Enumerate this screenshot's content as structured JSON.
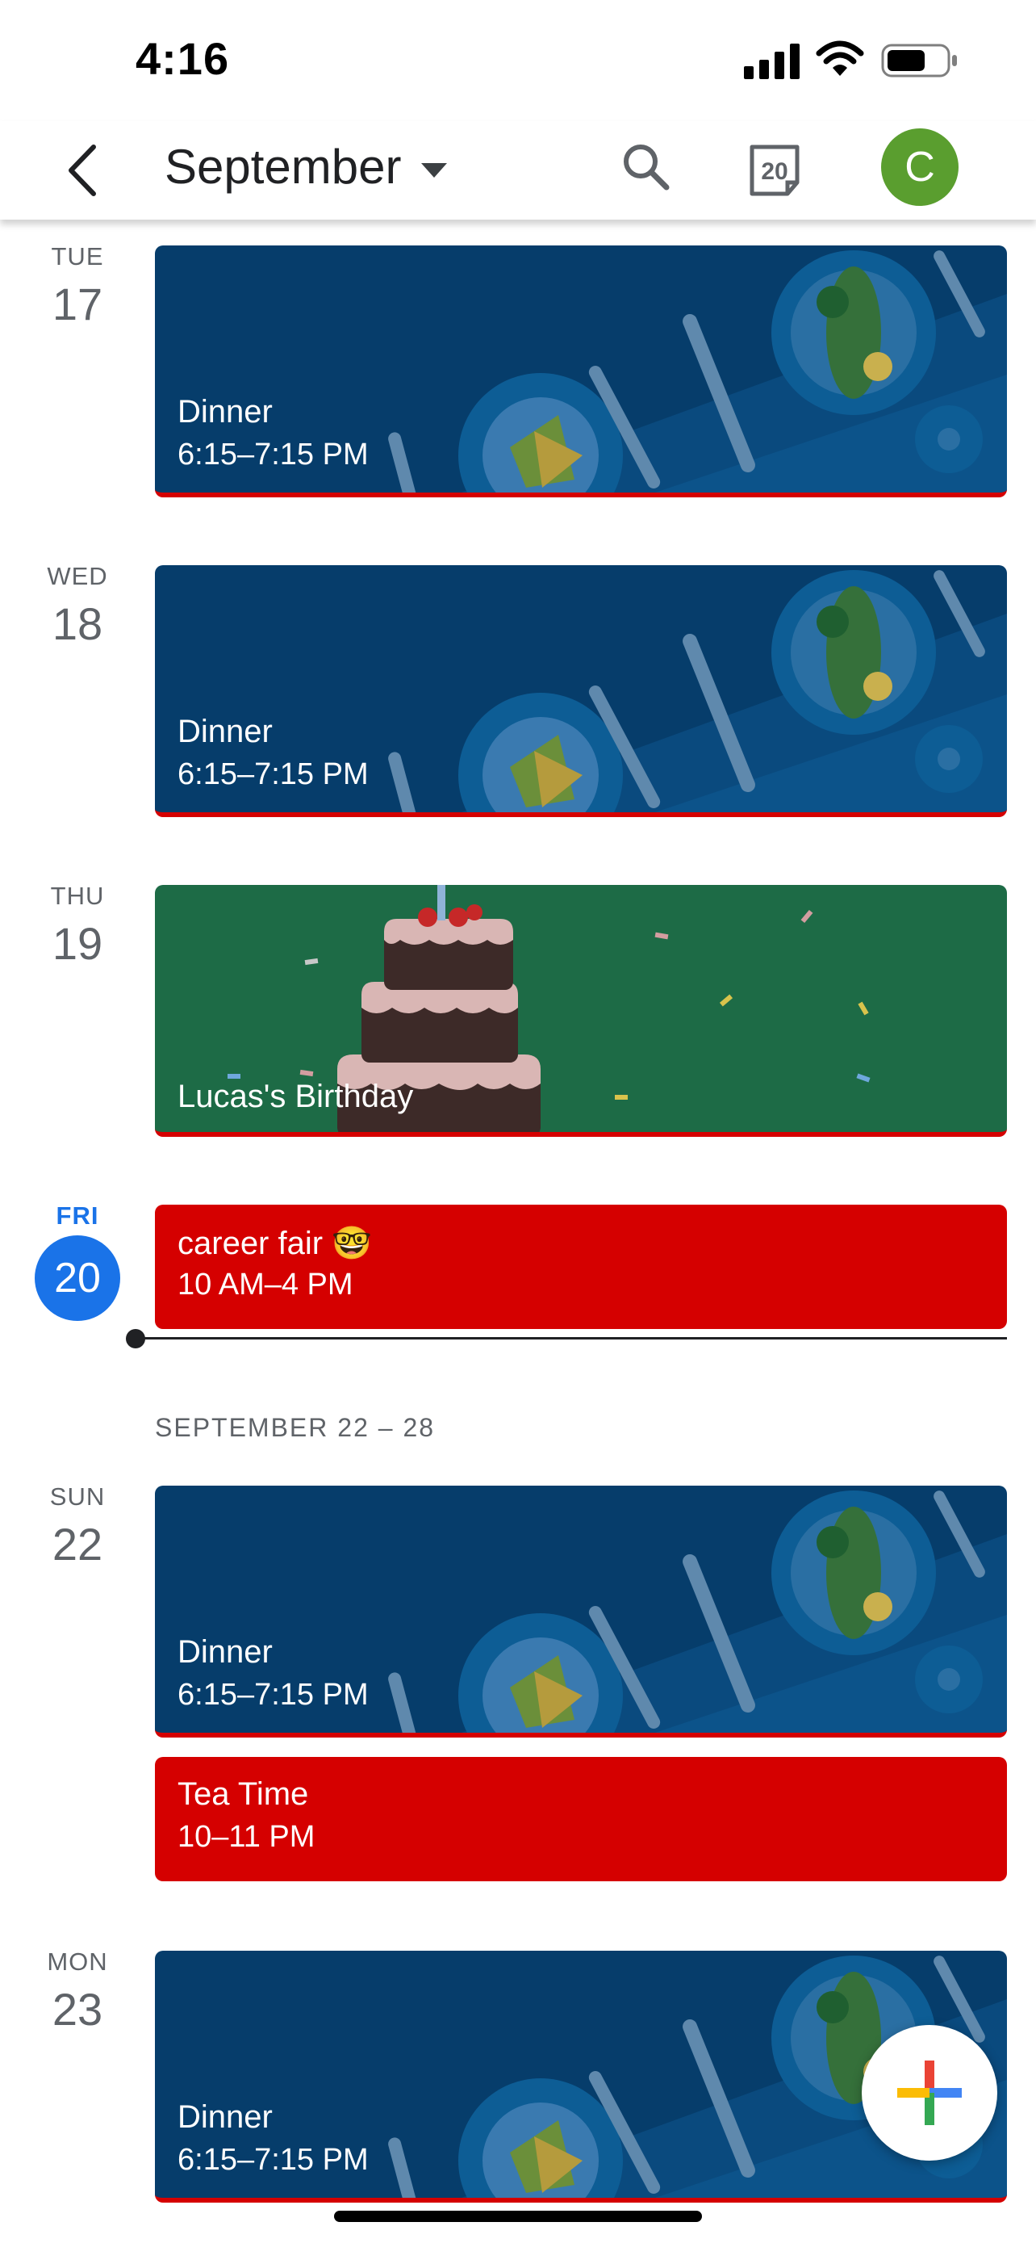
{
  "status_bar": {
    "time": "4:16"
  },
  "app_bar": {
    "month": "September",
    "today_number": "20",
    "avatar_initial": "C"
  },
  "days": [
    {
      "dow": "TUE",
      "date": "17"
    },
    {
      "dow": "WED",
      "date": "18"
    },
    {
      "dow": "THU",
      "date": "19"
    },
    {
      "dow": "FRI",
      "date": "20"
    },
    {
      "dow": "SUN",
      "date": "22"
    },
    {
      "dow": "MON",
      "date": "23"
    }
  ],
  "events": [
    {
      "title": "Dinner",
      "time": "6:15–7:15 PM"
    },
    {
      "title": "Dinner",
      "time": "6:15–7:15 PM"
    },
    {
      "title": "Lucas's Birthday"
    },
    {
      "title": "career fair 🤓",
      "time": "10 AM–4 PM"
    },
    {
      "title": "Dinner",
      "time": "6:15–7:15 PM"
    },
    {
      "title": "Tea Time",
      "time": "10–11 PM"
    },
    {
      "title": "Dinner",
      "time": "6:15–7:15 PM"
    }
  ],
  "week_header": "SEPTEMBER 22 – 28",
  "colors": {
    "accent": "#1a73e8",
    "event_red": "#d50000",
    "dinner_bg": "#063d6b",
    "birthday_bg": "#1d6b46",
    "avatar": "#5a9e2f"
  }
}
